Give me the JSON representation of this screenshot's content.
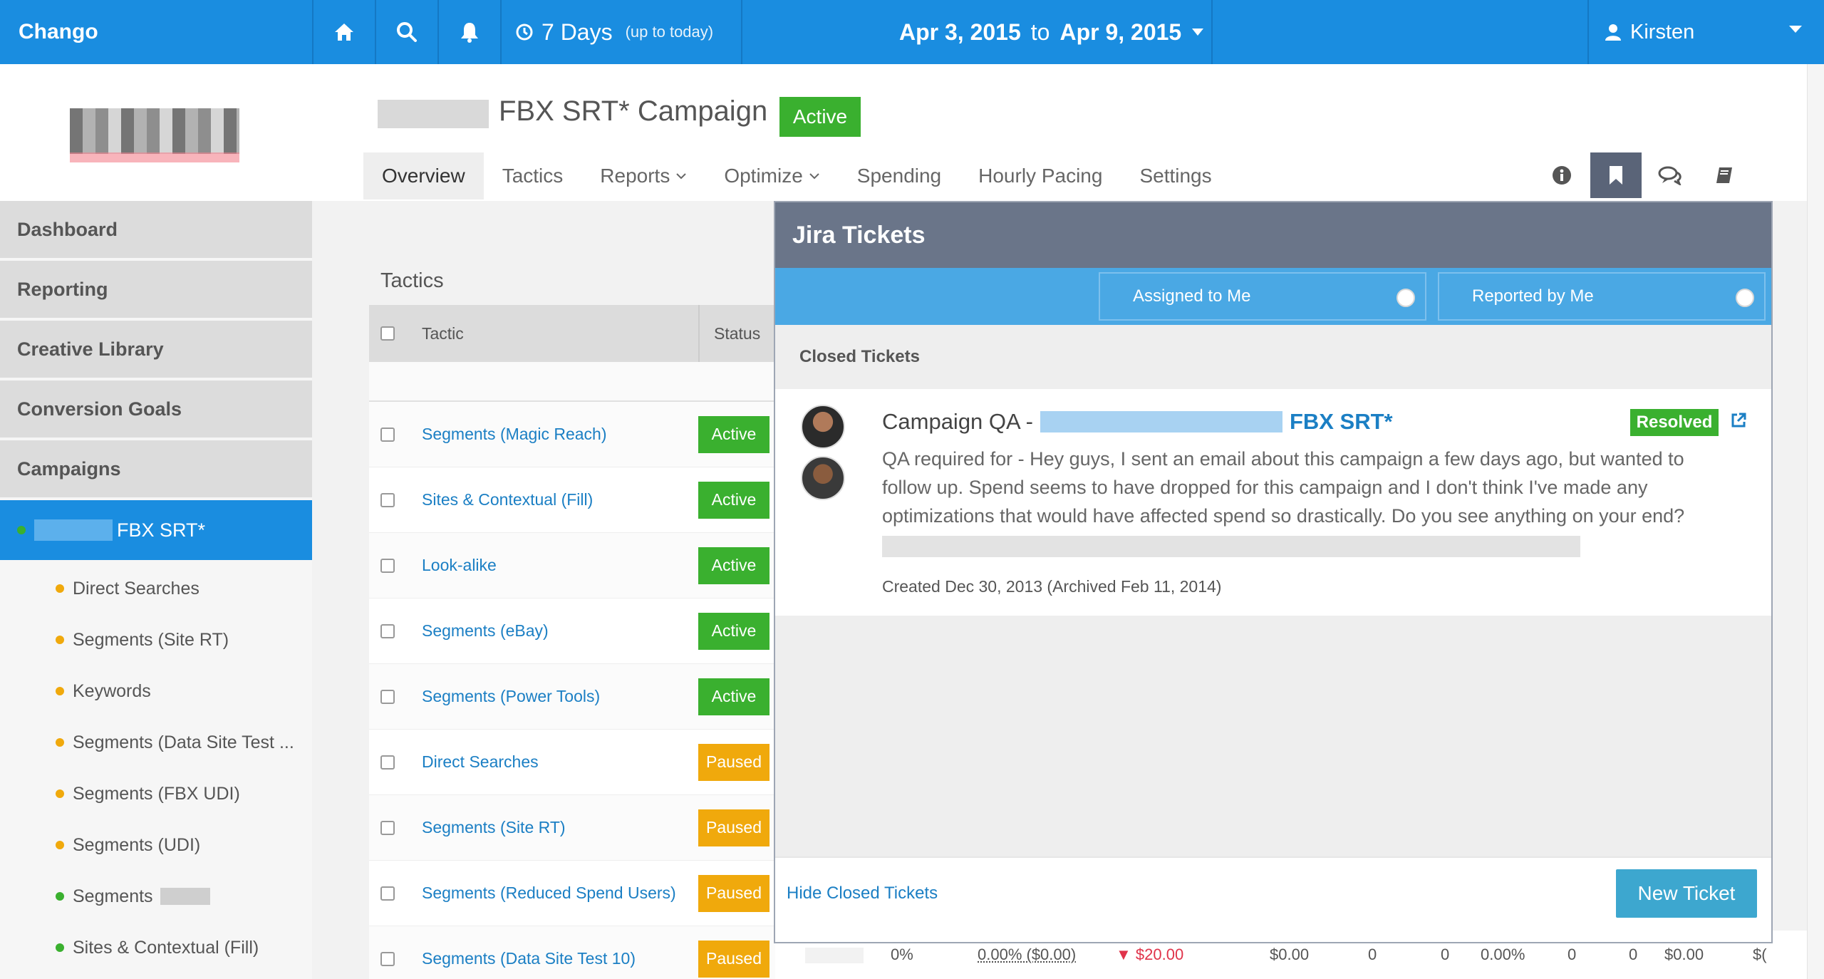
{
  "topbar": {
    "brand": "Chango",
    "range_main": "7 Days",
    "range_note": "(up to today)",
    "date_from": "Apr 3, 2015",
    "date_to_word": "to",
    "date_to": "Apr 9, 2015",
    "user_name": "Kirsten",
    "bg_color": "#1a8de0"
  },
  "campaign": {
    "title": "FBX SRT* Campaign",
    "status": "Active"
  },
  "tabs": [
    {
      "label": "Overview"
    },
    {
      "label": "Tactics"
    },
    {
      "label": "Reports"
    },
    {
      "label": "Optimize"
    },
    {
      "label": "Spending"
    },
    {
      "label": "Hourly Pacing"
    },
    {
      "label": "Settings"
    }
  ],
  "header_icons": [
    "info-icon",
    "bookmark-icon",
    "comments-icon",
    "book-icon"
  ],
  "sidebar": {
    "items": [
      {
        "label": "Dashboard"
      },
      {
        "label": "Reporting"
      },
      {
        "label": "Creative Library"
      },
      {
        "label": "Conversion Goals"
      },
      {
        "label": "Campaigns"
      }
    ],
    "current_campaign": "FBX SRT*",
    "sub_items": [
      {
        "label": "Direct Searches",
        "dot": "#f0a90c"
      },
      {
        "label": "Segments (Site RT)",
        "dot": "#f0a90c"
      },
      {
        "label": "Keywords",
        "dot": "#f0a90c"
      },
      {
        "label": "Segments (Data Site Test ...",
        "dot": "#f0a90c"
      },
      {
        "label": "Segments (FBX UDI)",
        "dot": "#f0a90c"
      },
      {
        "label": "Segments (UDI)",
        "dot": "#f0a90c"
      },
      {
        "label": "Segments",
        "dot": "#3ab02f"
      },
      {
        "label": "Sites & Contextual (Fill)",
        "dot": "#3ab02f"
      }
    ]
  },
  "tactics": {
    "heading": "Tactics",
    "col_tactic": "Tactic",
    "col_status": "Status",
    "rows": [
      {
        "name": "Segments (Magic Reach)",
        "status": "Active"
      },
      {
        "name": "Sites & Contextual (Fill)",
        "status": "Active"
      },
      {
        "name": "Look-alike",
        "status": "Active"
      },
      {
        "name": "Segments (eBay)",
        "status": "Active"
      },
      {
        "name": "Segments (Power Tools)",
        "status": "Active"
      },
      {
        "name": "Direct Searches",
        "status": "Paused"
      },
      {
        "name": "Segments (Site RT)",
        "status": "Paused"
      },
      {
        "name": "Segments (Reduced Spend Users)",
        "status": "Paused"
      },
      {
        "name": "Segments (Data Site Test 10)",
        "status": "Paused"
      }
    ]
  },
  "last_row_metrics": {
    "pct": "0%",
    "pct_spend": "0.00% ($0.00)",
    "delta": "▼ $20.00",
    "spend": "$0.00",
    "n1": "0",
    "n2": "0",
    "rate": "0.00%",
    "n3": "0",
    "n4": "0",
    "cost": "$0.00",
    "trail": "$("
  },
  "jira": {
    "title": "Jira Tickets",
    "filter_assigned": "Assigned to Me",
    "filter_reported": "Reported by Me",
    "closed_heading": "Closed Tickets",
    "ticket": {
      "title_prefix": "Campaign QA -",
      "title_campaign": "FBX SRT*",
      "badge": "Resolved",
      "body": "QA required for - Hey guys, I sent an email about this campaign a few days ago, but wanted to follow up. Spend seems to have dropped for this campaign and I don't think I've made any optimizations that would have affected spend so drastically. Do you see anything on your end?",
      "created": "Created Dec 30, 2013 (Archived Feb 11, 2014)"
    },
    "hide_closed": "Hide Closed Tickets",
    "new_ticket": "New Ticket"
  }
}
